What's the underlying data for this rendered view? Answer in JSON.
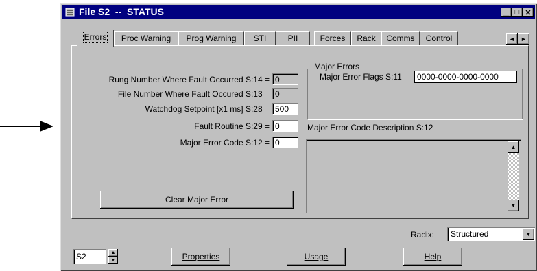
{
  "window": {
    "title": "File S2  --  STATUS",
    "controls": {
      "minimize": "▁",
      "maximize": "□",
      "close": "✕"
    }
  },
  "tabs": [
    {
      "label": "Errors",
      "active": true
    },
    {
      "label": "Proc Warning"
    },
    {
      "label": "Prog Warning"
    },
    {
      "label": "STI"
    },
    {
      "label": "PII"
    },
    {
      "label": "Forces"
    },
    {
      "label": "Rack"
    },
    {
      "label": "Comms"
    },
    {
      "label": "Control"
    }
  ],
  "tab_scroll": {
    "left": "◄",
    "right": "►"
  },
  "fields": {
    "rung_number": {
      "label": "Rung Number Where Fault Occurred S:14 =",
      "value": "0"
    },
    "file_number": {
      "label": "File Number Where Fault Occured S:13 =",
      "value": "0"
    },
    "watchdog": {
      "label": "Watchdog Setpoint [x1 ms] S:28 =",
      "value": "500"
    },
    "fault_routine": {
      "label": "Fault Routine S:29 =",
      "value": "0"
    },
    "major_error_code": {
      "label": "Major Error Code S:12 =",
      "value": "0"
    }
  },
  "major_errors": {
    "group_title": "Major Errors",
    "flags_label": "Major Error Flags S:11",
    "flags_value": "0000-0000-0000-0000"
  },
  "description": {
    "label": "Major Error Code Description S:12",
    "text": ""
  },
  "buttons": {
    "clear_major_error": "Clear Major Error",
    "properties": "Properties",
    "usage": "Usage",
    "help": "Help"
  },
  "radix": {
    "label": "Radix:",
    "value": "Structured"
  },
  "file_selector": {
    "value": "S2"
  },
  "colors": {
    "titlebar": "#000080",
    "face": "#c0c0c0"
  }
}
